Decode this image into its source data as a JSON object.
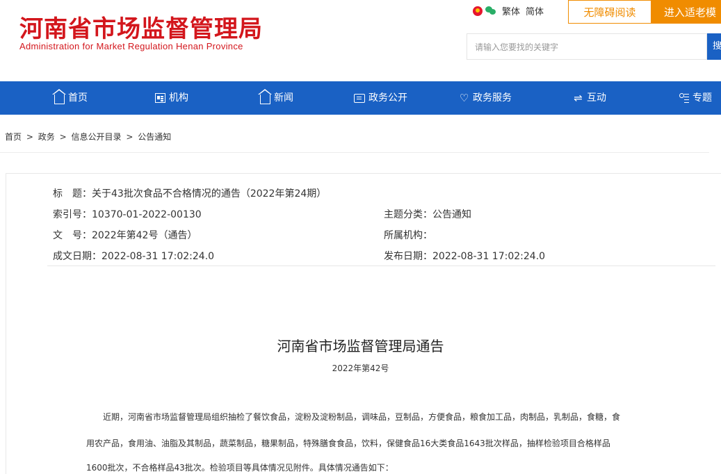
{
  "header": {
    "title": "河南省市场监督管理局",
    "subtitle": "Administration for Market Regulation Henan Province",
    "lang_traditional": "繁体",
    "lang_simplified": "简体",
    "accessibility_button": "无障碍阅读",
    "elder_button": "进入适老模",
    "search_placeholder": "请输入您要找的关键字",
    "search_button": "搜",
    "brand_color": "#d3161c",
    "accent_color": "#f08c00",
    "nav_color": "#1a61c4"
  },
  "nav": {
    "items": [
      {
        "label": "首页",
        "icon": "home-icon"
      },
      {
        "label": "机构",
        "icon": "organization-icon"
      },
      {
        "label": "新闻",
        "icon": "news-icon"
      },
      {
        "label": "政务公开",
        "icon": "government-affairs-icon"
      },
      {
        "label": "政务服务",
        "icon": "heart-icon"
      },
      {
        "label": "互动",
        "icon": "exchange-icon"
      },
      {
        "label": "专题",
        "icon": "topic-list-icon"
      }
    ]
  },
  "breadcrumb": {
    "items": [
      "首页",
      "政务",
      "信息公开目录",
      "公告通知"
    ],
    "separator": ">"
  },
  "meta": {
    "title_label": "标　题：",
    "title_value": "关于43批次食品不合格情况的通告（2022年第24期）",
    "index_label": "索引号：",
    "index_value": "10370-01-2022-00130",
    "category_label": "主题分类：",
    "category_value": "公告通知",
    "doc_no_label": "文　号：",
    "doc_no_value": "2022年第42号（通告）",
    "agency_label": "所属机构：",
    "agency_value": "",
    "created_label": "成文日期：",
    "created_value": "2022-08-31 17:02:24.0",
    "published_label": "发布日期：",
    "published_value": "2022-08-31 17:02:24.0"
  },
  "document": {
    "heading": "河南省市场监督管理局通告",
    "number": "2022年第42号",
    "paragraph_lines": [
      "近期，河南省市场监督管理局组织抽检了餐饮食品，淀粉及淀粉制品，调味品，豆制品，方便食品，粮食加工品，肉制品，乳制品，食糖，食",
      "用农产品，食用油、油脂及其制品，蔬菜制品，糖果制品，特殊膳食食品，饮料，保健食品16大类食品1643批次样品，抽样检验项目合格样品",
      "1600批次，不合格样品43批次。检验项目等具体情况见附件。具体情况通告如下："
    ]
  }
}
